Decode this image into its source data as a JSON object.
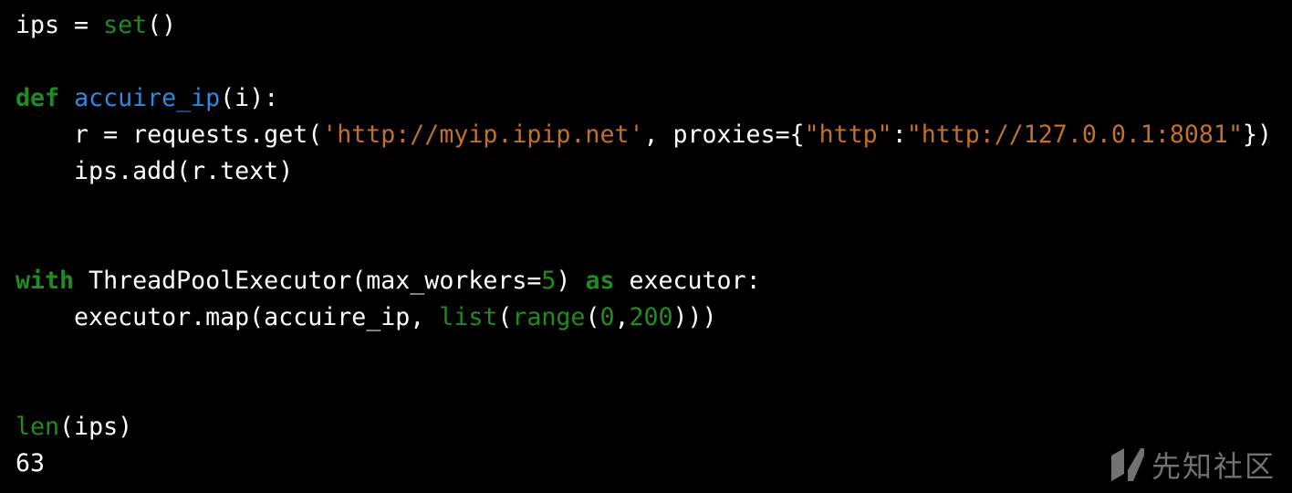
{
  "editor": {
    "lines": [
      [
        {
          "t": "ips = ",
          "c": "plain"
        },
        {
          "t": "set",
          "c": "builtin"
        },
        {
          "t": "()",
          "c": "plain"
        }
      ],
      [],
      [
        {
          "t": "def",
          "c": "kw"
        },
        {
          "t": " ",
          "c": "plain"
        },
        {
          "t": "accuire_ip",
          "c": "fn"
        },
        {
          "t": "(i):",
          "c": "plain"
        }
      ],
      [
        {
          "t": "    r = requests.get(",
          "c": "plain"
        },
        {
          "t": "'http://myip.ipip.net'",
          "c": "str"
        },
        {
          "t": ", proxies={",
          "c": "plain"
        },
        {
          "t": "\"http\"",
          "c": "str"
        },
        {
          "t": ":",
          "c": "plain"
        },
        {
          "t": "\"http://127.0.0.1:8081\"",
          "c": "str"
        },
        {
          "t": "})",
          "c": "plain"
        }
      ],
      [
        {
          "t": "    ips.add(r.text)",
          "c": "plain"
        }
      ],
      [],
      [],
      [
        {
          "t": "with",
          "c": "kw"
        },
        {
          "t": " ThreadPoolExecutor(max_workers=",
          "c": "plain"
        },
        {
          "t": "5",
          "c": "num"
        },
        {
          "t": ") ",
          "c": "plain"
        },
        {
          "t": "as",
          "c": "kw"
        },
        {
          "t": " executor:",
          "c": "plain"
        }
      ],
      [
        {
          "t": "    executor.map(accuire_ip, ",
          "c": "plain"
        },
        {
          "t": "list",
          "c": "builtin"
        },
        {
          "t": "(",
          "c": "plain"
        },
        {
          "t": "range",
          "c": "builtin"
        },
        {
          "t": "(",
          "c": "plain"
        },
        {
          "t": "0",
          "c": "num"
        },
        {
          "t": ",",
          "c": "plain"
        },
        {
          "t": "200",
          "c": "num"
        },
        {
          "t": ")))",
          "c": "plain"
        }
      ],
      [],
      [],
      [
        {
          "t": "len",
          "c": "builtin"
        },
        {
          "t": "(ips)",
          "c": "plain"
        }
      ],
      [
        {
          "t": "63",
          "c": "plain"
        }
      ]
    ]
  },
  "watermark": {
    "text": "先知社区",
    "icon": "xianzhi-logo-icon"
  }
}
